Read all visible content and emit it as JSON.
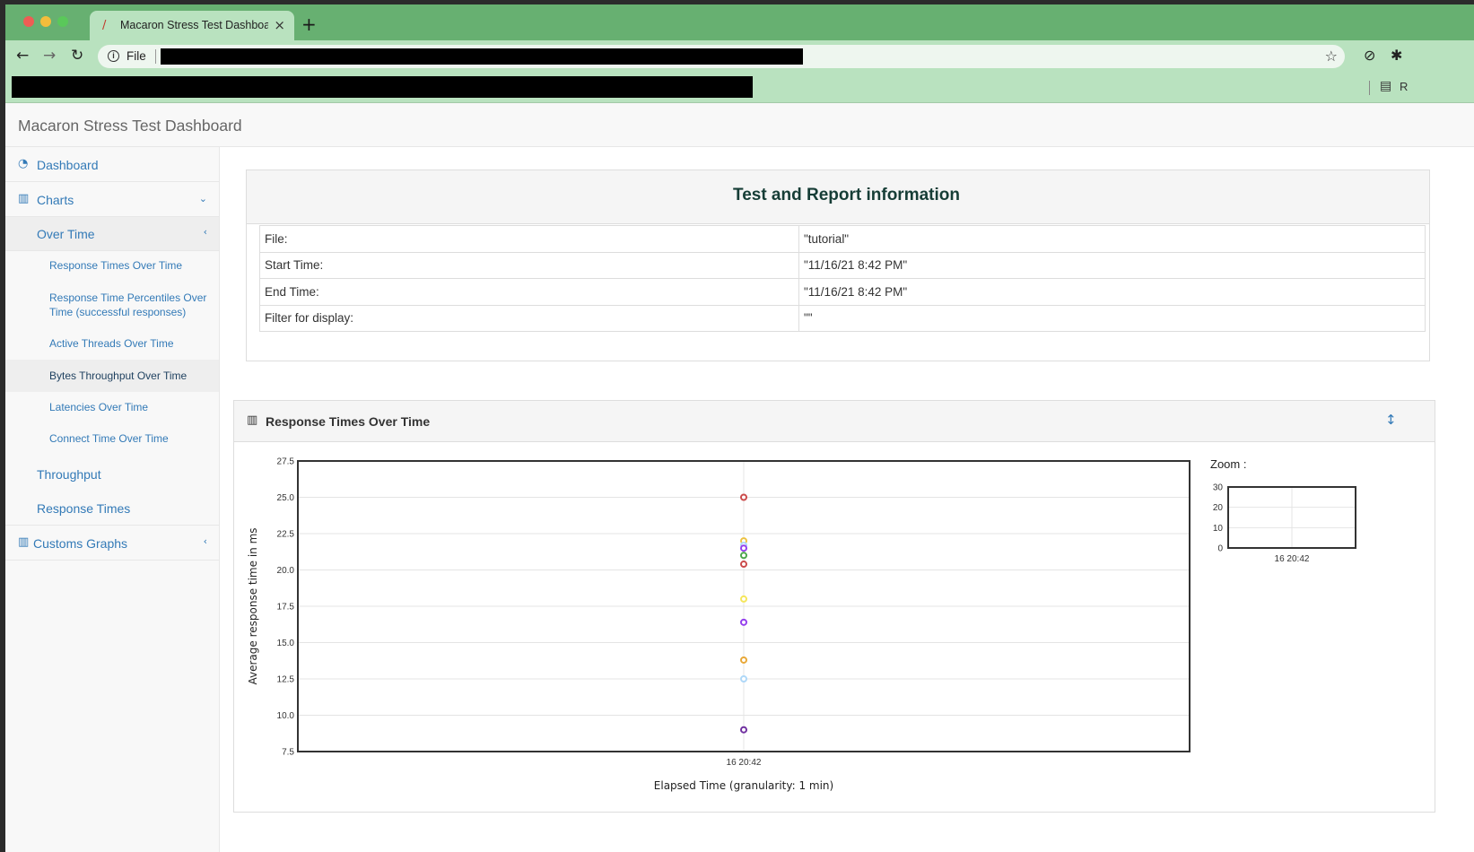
{
  "browser": {
    "tab_title": "Macaron Stress Test Dashboard",
    "tab_favicon": "feather-icon",
    "scheme_label": "File",
    "bookmark_partial": "R"
  },
  "navbar": {
    "brand": "Macaron Stress Test Dashboard"
  },
  "sidebar": {
    "dashboard": "Dashboard",
    "charts": "Charts",
    "over_time": "Over Time",
    "sub_items": [
      "Response Times Over Time",
      "Response Time Percentiles Over Time (successful responses)",
      "Active Threads Over Time",
      "Bytes Throughput Over Time",
      "Latencies Over Time",
      "Connect Time Over Time"
    ],
    "throughput": "Throughput",
    "response_times": "Response Times",
    "custom_graphs": "Customs Graphs"
  },
  "info": {
    "title": "Test and Report information",
    "rows": [
      {
        "key": "File:",
        "value": "\"tutorial\""
      },
      {
        "key": "Start Time:",
        "value": "\"11/16/21 8:42 PM\""
      },
      {
        "key": "End Time:",
        "value": "\"11/16/21 8:42 PM\""
      },
      {
        "key": "Filter for display:",
        "value": "\"\""
      }
    ]
  },
  "chart_panel": {
    "title": "Response Times Over Time",
    "zoom_label": "Zoom :"
  },
  "chart_data": [
    {
      "type": "scatter",
      "title": "",
      "xlabel": "Elapsed Time (granularity: 1 min)",
      "ylabel": "Average response time in ms",
      "x": [
        "16 20:42"
      ],
      "ylim": [
        7.5,
        27.5
      ],
      "yticks": [
        "7.5",
        "10.0",
        "12.5",
        "15.0",
        "17.5",
        "20.0",
        "22.5",
        "25.0",
        "27.5"
      ],
      "grid": true,
      "points": [
        {
          "y": 25.0,
          "color": "#cb4b4b"
        },
        {
          "y": 22.0,
          "color": "#edc240"
        },
        {
          "y": 21.7,
          "color": "#afd8f8"
        },
        {
          "y": 21.5,
          "color": "#9440ed"
        },
        {
          "y": 21.0,
          "color": "#4da74d"
        },
        {
          "y": 20.4,
          "color": "#cb4b4b"
        },
        {
          "y": 18.0,
          "color": "#f5e65b"
        },
        {
          "y": 16.4,
          "color": "#9440ed"
        },
        {
          "y": 13.8,
          "color": "#e8a838"
        },
        {
          "y": 12.5,
          "color": "#afd8f8"
        },
        {
          "y": 9.0,
          "color": "#7030a0"
        }
      ]
    },
    {
      "type": "line",
      "title": "",
      "x": [
        "16 20:42"
      ],
      "ylim": [
        0,
        30
      ],
      "yticks": [
        "0",
        "10",
        "20",
        "30"
      ]
    }
  ]
}
